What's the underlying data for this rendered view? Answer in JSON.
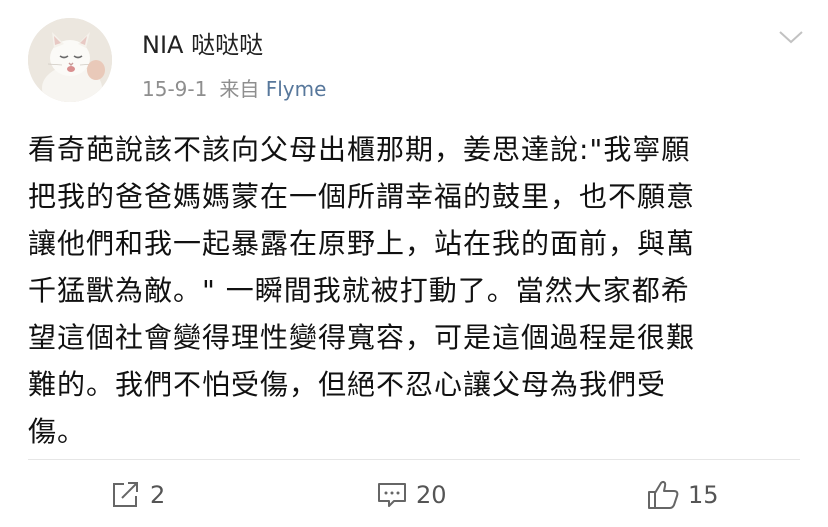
{
  "header": {
    "username": "NIA 哒哒哒",
    "date": "15-9-1",
    "source_prefix": "来自",
    "source_name": "Flyme"
  },
  "post": {
    "lines": [
      "看奇葩說該不該向父母出櫃那期，姜思達說:\"我寧願",
      "把我的爸爸媽媽蒙在一個所謂幸福的鼓里，也不願意",
      "讓他們和我一起暴露在原野上，站在我的面前，與萬",
      "千猛獸為敵。\" 一瞬間我就被打動了。當然大家都希",
      "望這個社會變得理性變得寬容，可是這個過程是很艱",
      "難的。我們不怕受傷，但絕不忍心讓父母為我們受",
      "傷。"
    ]
  },
  "actions": {
    "repost": {
      "icon": "repost-icon",
      "count": "2"
    },
    "comment": {
      "icon": "comment-icon",
      "count": "20"
    },
    "like": {
      "icon": "thumbs-up-icon",
      "count": "15"
    }
  },
  "colors": {
    "source_link": "#57779b",
    "meta_gray": "#8e8e8e",
    "text": "#111111",
    "icon_gray": "#666666"
  }
}
